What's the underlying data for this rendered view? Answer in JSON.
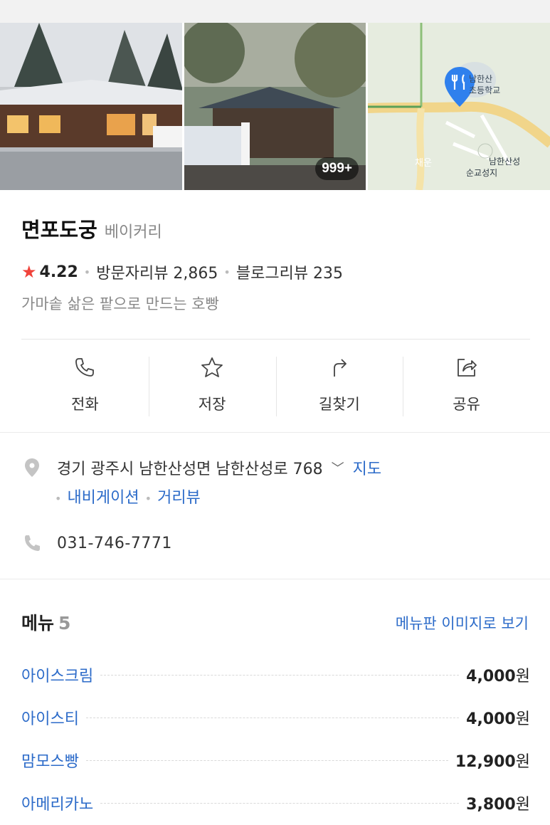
{
  "place": {
    "name": "면포도궁",
    "category": "베이커리",
    "rating": "4.22",
    "visitor_reviews": "방문자리뷰 2,865",
    "blog_reviews": "블로그리뷰 235",
    "description": "가마솥 삶은 팥으로 만드는 호빵"
  },
  "photos": {
    "more_count": "999+",
    "map_labels": [
      "남한산",
      "초등학교",
      "채운",
      "남한산성",
      "순교성지"
    ]
  },
  "actions": [
    {
      "label": "전화",
      "icon": "phone-icon"
    },
    {
      "label": "저장",
      "icon": "star-outline-icon"
    },
    {
      "label": "길찾기",
      "icon": "directions-icon"
    },
    {
      "label": "공유",
      "icon": "share-icon"
    }
  ],
  "address": {
    "text": "경기 광주시 남한산성면 남한산성로 768",
    "map_link": "지도",
    "navigation_link": "내비게이션",
    "street_view_link": "거리뷰"
  },
  "phone": "031-746-7771",
  "menu": {
    "title": "메뉴",
    "count": "5",
    "board_link": "메뉴판 이미지로 보기",
    "items": [
      {
        "name": "아이스크림",
        "price": "4,000",
        "unit": "원"
      },
      {
        "name": "아이스티",
        "price": "4,000",
        "unit": "원"
      },
      {
        "name": "맘모스빵",
        "price": "12,900",
        "unit": "원"
      },
      {
        "name": "아메리카노",
        "price": "3,800",
        "unit": "원"
      }
    ]
  },
  "colors": {
    "link": "#2c6bc9",
    "star": "#f0423a",
    "map_pin": "#2f80ed"
  }
}
